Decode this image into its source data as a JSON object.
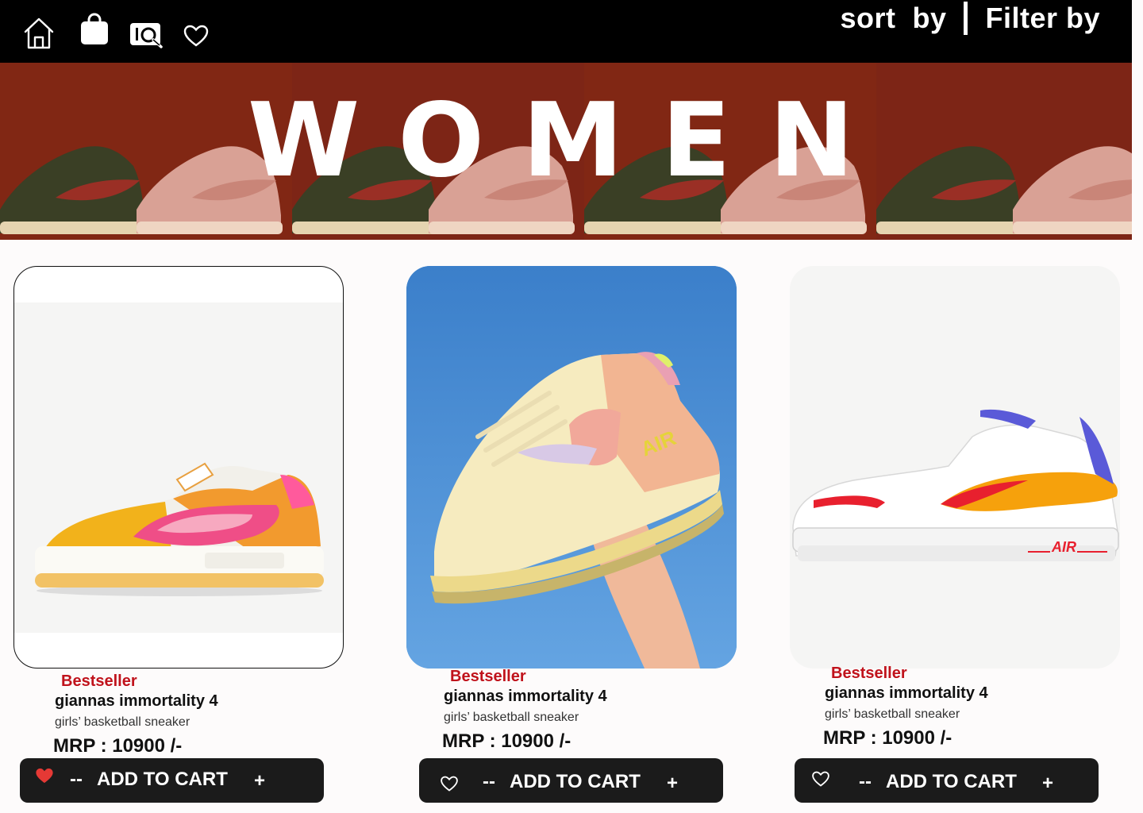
{
  "nav": {
    "icons": [
      "home-icon",
      "shopping-bag-icon",
      "visual-search-icon",
      "heart-icon"
    ],
    "sort_label": "sort  by",
    "filter_label": "Filter by"
  },
  "banner": {
    "title": "WOMEN"
  },
  "colors": {
    "topbar": "#000000",
    "banner_bg": "#7a2313",
    "badge": "#c0121b",
    "button_bg": "#1b1b1b",
    "liked_heart": "#e53935"
  },
  "products": [
    {
      "badge": "Bestseller",
      "name": "giannas immortality 4",
      "desc": "girls’ basketball sneaker",
      "price": "MRP : 10900 /-",
      "cart_label": "ADD TO CART",
      "minus": "--",
      "plus": "+",
      "liked": true
    },
    {
      "badge": "Bestseller",
      "name": "giannas immortality 4",
      "desc": "girls’ basketball sneaker",
      "price": "MRP : 10900 /-",
      "cart_label": "ADD TO CART",
      "minus": "--",
      "plus": "+",
      "liked": false
    },
    {
      "badge": "Bestseller",
      "name": "giannas immortality 4",
      "desc": "girls’ basketball sneaker",
      "price": "MRP : 10900 /-",
      "cart_label": "ADD TO CART",
      "minus": "--",
      "plus": "+",
      "liked": false
    }
  ]
}
